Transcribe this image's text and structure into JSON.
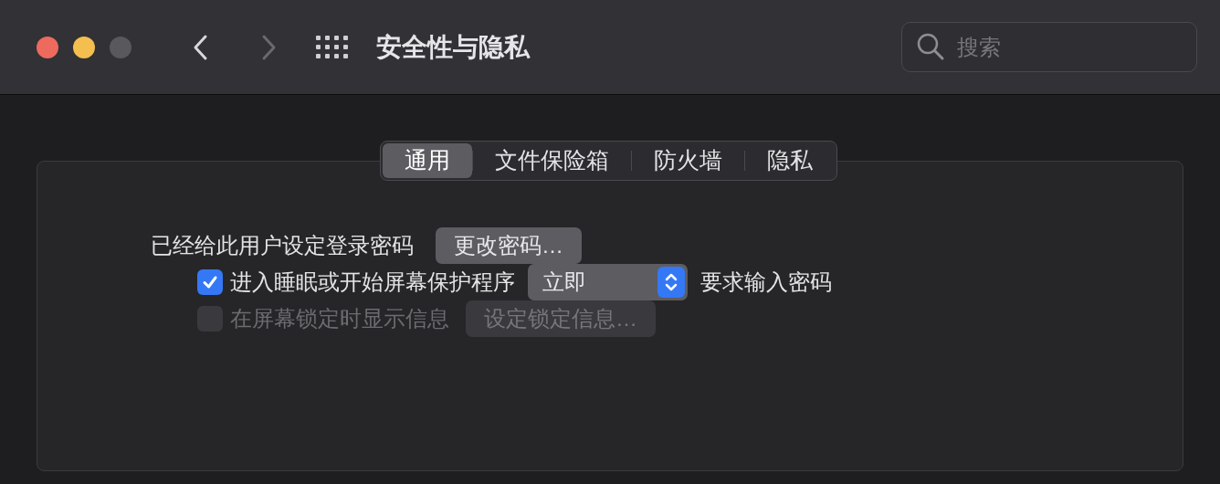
{
  "window": {
    "title": "安全性与隐私",
    "back_disabled": false,
    "forward_disabled": true,
    "zoom_disabled": true
  },
  "search": {
    "placeholder": "搜索"
  },
  "tabs": [
    {
      "label": "通用",
      "selected": true
    },
    {
      "label": "文件保险箱",
      "selected": false
    },
    {
      "label": "防火墙",
      "selected": false
    },
    {
      "label": "隐私",
      "selected": false
    }
  ],
  "password": {
    "label": "已经给此用户设定登录密码",
    "button": "更改密码…"
  },
  "options": [
    {
      "kind": "popup",
      "checked": true,
      "disabled": false,
      "label": "进入睡眠或开始屏幕保护程序",
      "value": "立即",
      "suffix": "要求输入密码"
    },
    {
      "kind": "button",
      "checked": false,
      "disabled": true,
      "label": "在屏幕锁定时显示信息",
      "button": "设定锁定信息…"
    }
  ]
}
